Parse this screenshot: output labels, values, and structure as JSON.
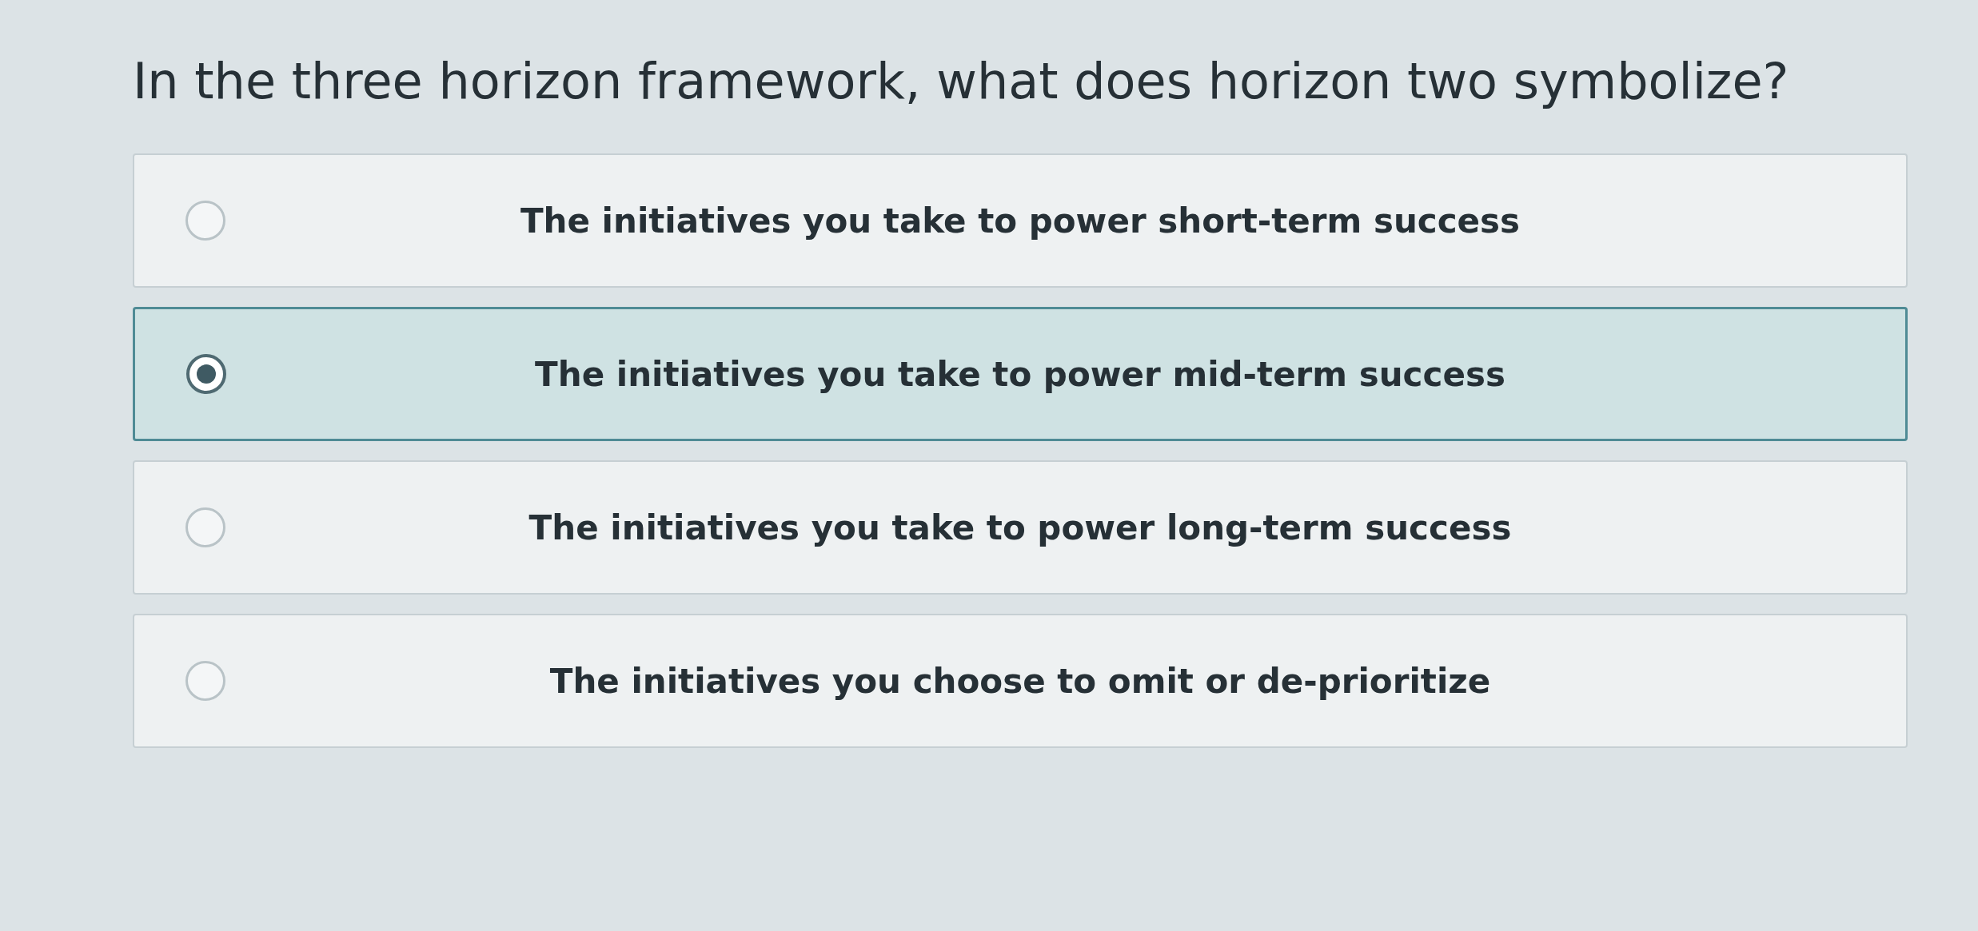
{
  "question": "In the three horizon framework, what does horizon two symbolize?",
  "options": [
    {
      "label": "The initiatives you take to power short-term success",
      "selected": false
    },
    {
      "label": "The initiatives you take to power mid-term success",
      "selected": true
    },
    {
      "label": "The initiatives you take to power long-term success",
      "selected": false
    },
    {
      "label": "The initiatives you choose to omit or de-prioritize",
      "selected": false
    }
  ]
}
